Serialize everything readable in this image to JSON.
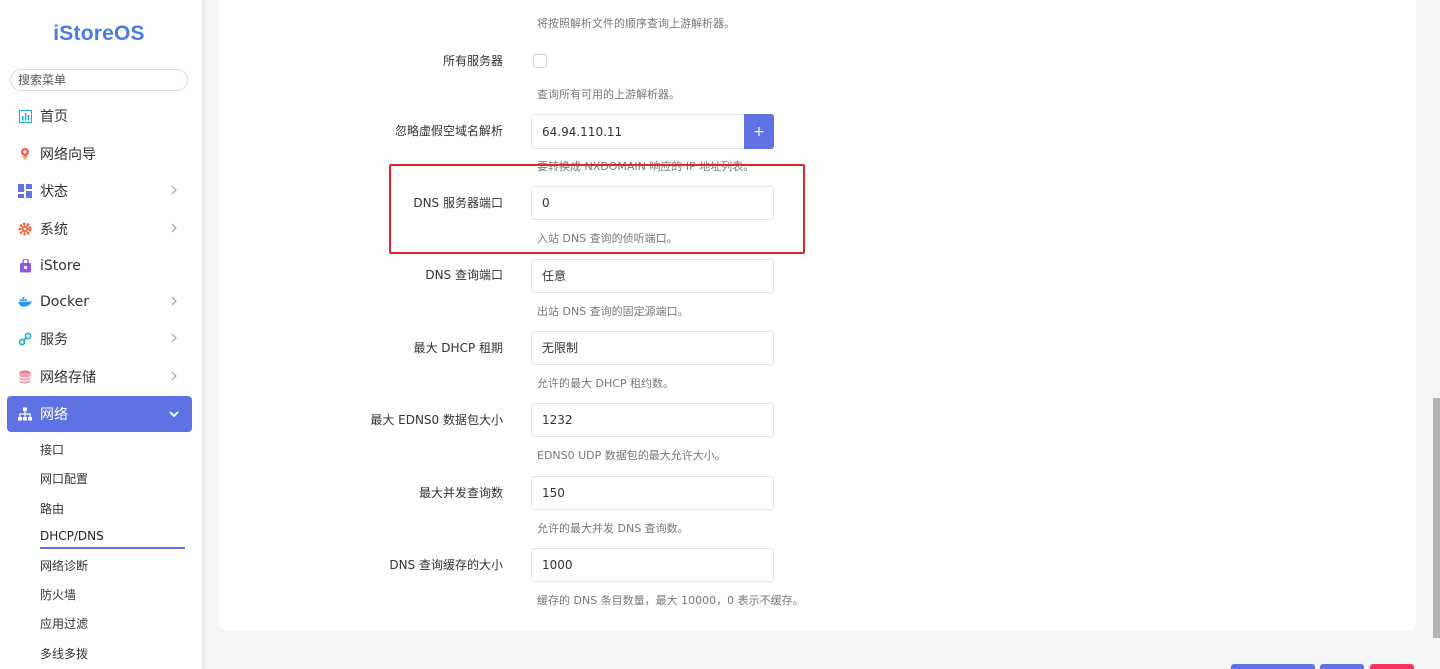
{
  "app": {
    "logo": "iStoreOS"
  },
  "search": {
    "placeholder": "搜索菜单"
  },
  "menu": {
    "home": "首页",
    "wizard": "网络向导",
    "status": "状态",
    "system": "系统",
    "istore": "iStore",
    "docker": "Docker",
    "services": "服务",
    "storage": "网络存储",
    "network": "网络"
  },
  "submenu": {
    "interfaces": "接口",
    "port_config": "网口配置",
    "routes": "路由",
    "dhcp_dns": "DHCP/DNS",
    "diagnostics": "网络诊断",
    "firewall": "防火墙",
    "app_filter": "应用过滤",
    "multiwan": "多线多拨"
  },
  "form": {
    "top_hint": "将按照解析文件的顺序查询上游解析器。",
    "all_servers": {
      "label": "所有服务器",
      "hint": "查询所有可用的上游解析器。",
      "checked": false
    },
    "bogus_nx": {
      "label": "忽略虚假空域名解析",
      "value": "64.94.110.11",
      "add": "+",
      "hint": "要转换成 NXDOMAIN 响应的 IP 地址列表。"
    },
    "dns_port": {
      "label": "DNS 服务器端口",
      "placeholder": "0",
      "hint": "入站 DNS 查询的侦听端口。"
    },
    "query_port": {
      "label": "DNS 查询端口",
      "placeholder": "任意",
      "hint": "出站 DNS 查询的固定源端口。"
    },
    "dhcp_lease": {
      "label": "最大 DHCP 租期",
      "placeholder": "无限制",
      "hint": "允许的最大 DHCP 租约数。"
    },
    "edns": {
      "label": "最大 EDNS0 数据包大小",
      "placeholder": "1232",
      "hint": "EDNS0 UDP 数据包的最大允许大小。"
    },
    "concurrent": {
      "label": "最大并发查询数",
      "placeholder": "150",
      "hint": "允许的最大并发 DNS 查询数。"
    },
    "cache": {
      "label": "DNS 查询缓存的大小",
      "placeholder": "1000",
      "hint": "缓存的 DNS 条目数量，最大 10000，0 表示不缓存。"
    }
  },
  "colors": {
    "accent": "#5e72e4",
    "highlight": "#e0262a"
  }
}
